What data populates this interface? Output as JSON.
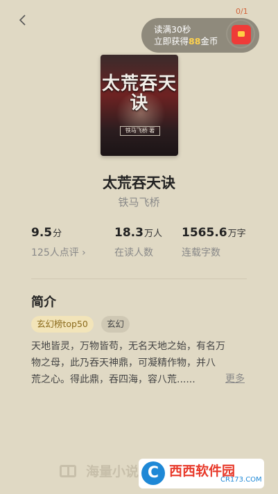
{
  "nav": {
    "back_glyph": "‹"
  },
  "reward": {
    "line1": "读满30秒",
    "line2_prefix": "立即获得",
    "coins": "88",
    "line2_suffix": "金币",
    "progress": "0/1",
    "icon": "red-packet-icon"
  },
  "book": {
    "cover_title": "太荒吞天诀",
    "cover_author": "铁马飞桥 著",
    "title": "太荒吞天诀",
    "author": "铁马飞桥"
  },
  "stats": {
    "rating_value": "9.5",
    "rating_unit": "分",
    "rating_label": "125人点评 ›",
    "readers_value": "18.3",
    "readers_unit": "万人",
    "readers_label": "在读人数",
    "words_value": "1565.6",
    "words_unit": "万字",
    "words_label": "连载字数"
  },
  "intro": {
    "heading": "简介",
    "tags": [
      "玄幻榜top50",
      "玄幻"
    ],
    "lines": [
      "天地皆灵，万物皆苟，无名天地之始，有名万",
      "物之母，此乃吞天神鼎，可凝精作物，并八",
      "荒之心。得此鼎，吞四海，容八荒......"
    ],
    "more": "更多"
  },
  "bottom": {
    "label": "海量小说"
  },
  "watermark": {
    "logo": "C",
    "main": "西西软件园",
    "sub": "CR173.COM"
  }
}
